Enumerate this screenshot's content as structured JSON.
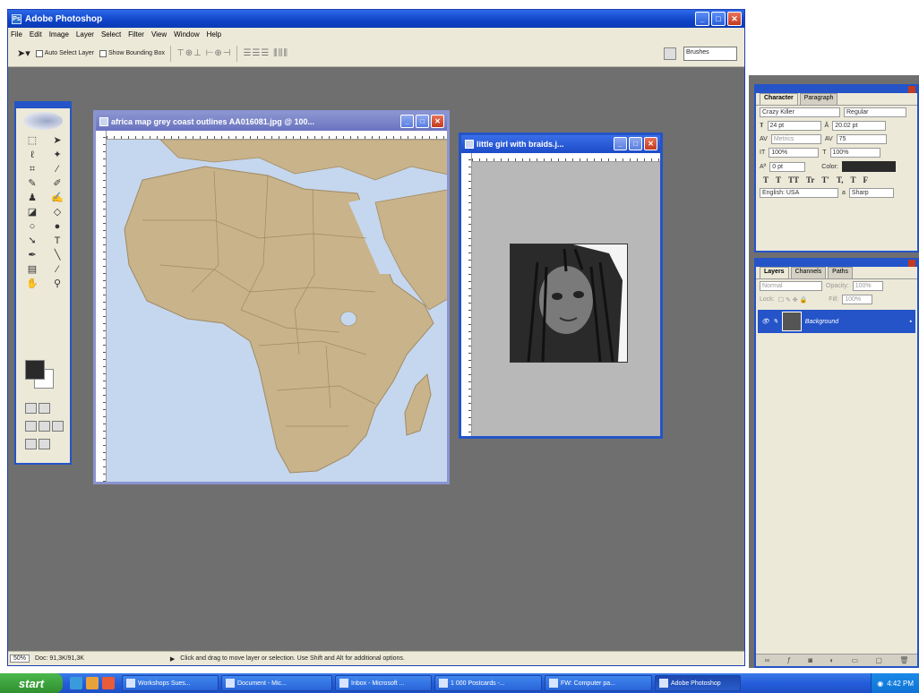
{
  "app": {
    "title": "Adobe Photoshop",
    "menu": [
      "File",
      "Edit",
      "Image",
      "Layer",
      "Select",
      "Filter",
      "View",
      "Window",
      "Help"
    ],
    "options": {
      "auto_select_layer": "Auto Select Layer",
      "show_bounding_box": "Show Bounding Box",
      "brushes": "Brushes"
    },
    "status": {
      "zoom": "50%",
      "doc": "Doc: 91,3K/91,3K",
      "hint": "Click and drag to move layer or selection. Use Shift and Alt for additional options."
    }
  },
  "docs": {
    "map_title": "africa map grey coast outlines AA016081.jpg @ 100...",
    "girl_title": "little girl with braids.j..."
  },
  "character": {
    "tabs": [
      "Character",
      "Paragraph"
    ],
    "font": "Crazy Killer",
    "style": "Regular",
    "size": "24 pt",
    "leading": "20.02 pt",
    "kerning": "Metrics",
    "tracking": "75",
    "vscale": "100%",
    "hscale": "100%",
    "baseline": "0 pt",
    "color_label": "Color:",
    "language": "English: USA",
    "aa": "Sharp",
    "aa_label": "a",
    "styles": [
      "T",
      "T",
      "TT",
      "Tr",
      "T'",
      "T,",
      "T",
      "F"
    ]
  },
  "layers": {
    "tabs": [
      "Layers",
      "Channels",
      "Paths"
    ],
    "blend": "Normal",
    "opacity_label": "Opacity:",
    "opacity": "100%",
    "lock_label": "Lock:",
    "fill_label": "Fill:",
    "fill": "100%",
    "layer_name": "Background"
  },
  "taskbar": {
    "start": "start",
    "items": [
      "Workshops Sues...",
      "Document - Mic...",
      "Inbox - Microsoft ...",
      "1 000 Postcards -...",
      "FW: Computer pa...",
      "Adobe Photoshop"
    ],
    "clock": "4:42 PM"
  }
}
